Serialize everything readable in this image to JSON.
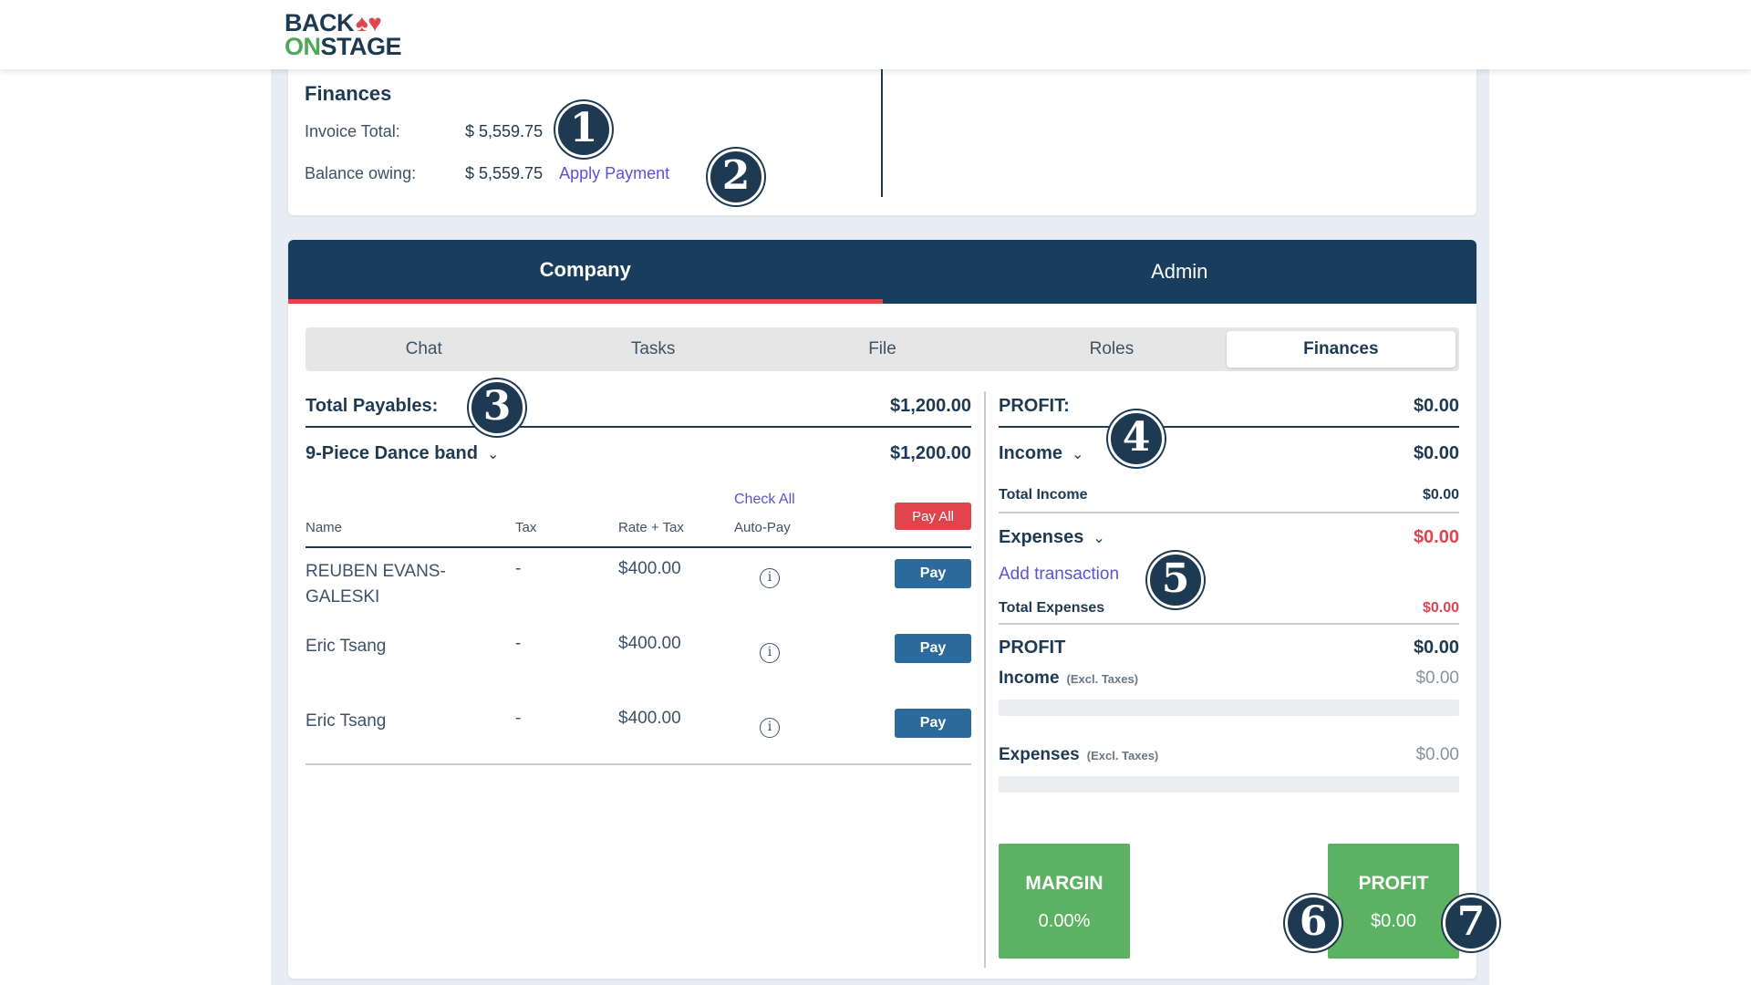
{
  "logo": {
    "line1": "BACK",
    "line2_a": "ON",
    "line2_b": "STAGE"
  },
  "finances_card": {
    "title": "Finances",
    "invoice_total_label": "Invoice Total:",
    "invoice_total_value": "$ 5,559.75",
    "balance_label": "Balance owing:",
    "balance_value": "$ 5,559.75",
    "apply_payment": "Apply Payment"
  },
  "main_tabs": [
    "Company",
    "Admin"
  ],
  "sub_tabs": [
    "Chat",
    "Tasks",
    "File",
    "Roles",
    "Finances"
  ],
  "payables": {
    "total_label": "Total Payables:",
    "total_value": "$1,200.00",
    "group_name": "9-Piece Dance band",
    "group_value": "$1,200.00",
    "columns": {
      "name": "Name",
      "tax": "Tax",
      "rate": "Rate + Tax",
      "autopay": "Auto-Pay"
    },
    "check_all": "Check All",
    "pay_all": "Pay All",
    "pay_label": "Pay",
    "rows": [
      {
        "name": "REUBEN EVANS-GALESKI",
        "tax": "-",
        "rate": "$400.00"
      },
      {
        "name": "Eric Tsang",
        "tax": "-",
        "rate": "$400.00"
      },
      {
        "name": "Eric Tsang",
        "tax": "-",
        "rate": "$400.00"
      }
    ]
  },
  "summary": {
    "profit_label": "PROFIT:",
    "profit_value": "$0.00",
    "income_label": "Income",
    "income_value": "$0.00",
    "total_income_label": "Total Income",
    "total_income_value": "$0.00",
    "expenses_label": "Expenses",
    "expenses_value": "$0.00",
    "add_transaction": "Add transaction",
    "total_expenses_label": "Total Expenses",
    "total_expenses_value": "$0.00",
    "profit2_label": "PROFIT",
    "profit2_value": "$0.00",
    "income_ex_label": "Income",
    "excl_taxes": "(Excl. Taxes)",
    "income_ex_value": "$0.00",
    "expenses_ex_label": "Expenses",
    "expenses_ex_value": "$0.00",
    "margin_label": "MARGIN",
    "margin_value": "0.00%",
    "profit_tile_label": "PROFIT",
    "profit_tile_value": "$0.00"
  },
  "callouts": [
    "1",
    "2",
    "3",
    "4",
    "5",
    "6",
    "7"
  ],
  "colors": {
    "navy": "#183d5d",
    "accent_red": "#e0444d",
    "link": "#5a53d6",
    "pay_blue": "#2b6a9a",
    "green": "#5cb262"
  },
  "icons": [
    "info-icon",
    "chevron-down-icon"
  ]
}
